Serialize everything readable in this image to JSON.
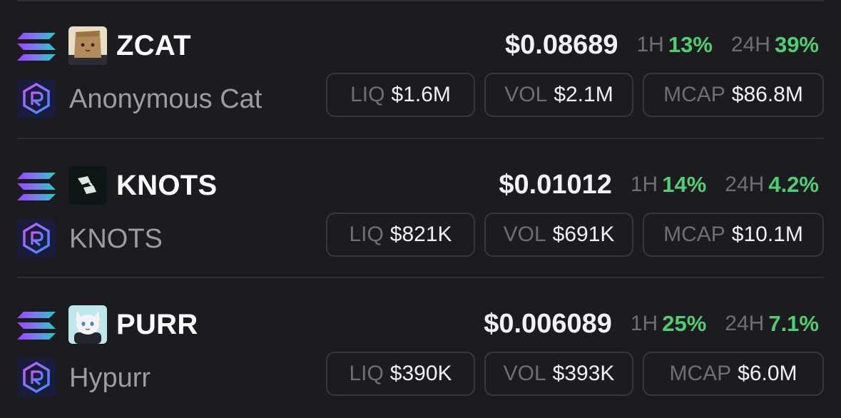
{
  "colors": {
    "background": "#1c1b20",
    "divider": "#302f36",
    "pill_border": "#38373e",
    "positive": "#4fcf72",
    "muted_text": "#6f6e75",
    "name_text": "#9d9ca3"
  },
  "icons": {
    "chain": "solana-icon",
    "dex": "raydium-icon"
  },
  "tokens": [
    {
      "symbol": "ZCAT",
      "name": "Anonymous Cat",
      "avatar": "paper-bag-cat-avatar",
      "price": "$0.08689",
      "h1_label": "1H",
      "h1_change": "13%",
      "h24_label": "24H",
      "h24_change": "39%",
      "liq_label": "LIQ",
      "liq": "$1.6M",
      "vol_label": "VOL",
      "vol": "$2.1M",
      "mcap_label": "MCAP",
      "mcap": "$86.8M"
    },
    {
      "symbol": "KNOTS",
      "name": "KNOTS",
      "avatar": "knots-logo-avatar",
      "price": "$0.01012",
      "h1_label": "1H",
      "h1_change": "14%",
      "h24_label": "24H",
      "h24_change": "4.2%",
      "liq_label": "LIQ",
      "liq": "$821K",
      "vol_label": "VOL",
      "vol": "$691K",
      "mcap_label": "MCAP",
      "mcap": "$10.1M"
    },
    {
      "symbol": "PURR",
      "name": "Hypurr",
      "avatar": "white-cat-avatar",
      "price": "$0.006089",
      "h1_label": "1H",
      "h1_change": "25%",
      "h24_label": "24H",
      "h24_change": "7.1%",
      "liq_label": "LIQ",
      "liq": "$390K",
      "vol_label": "VOL",
      "vol": "$393K",
      "mcap_label": "MCAP",
      "mcap": "$6.0M"
    }
  ]
}
